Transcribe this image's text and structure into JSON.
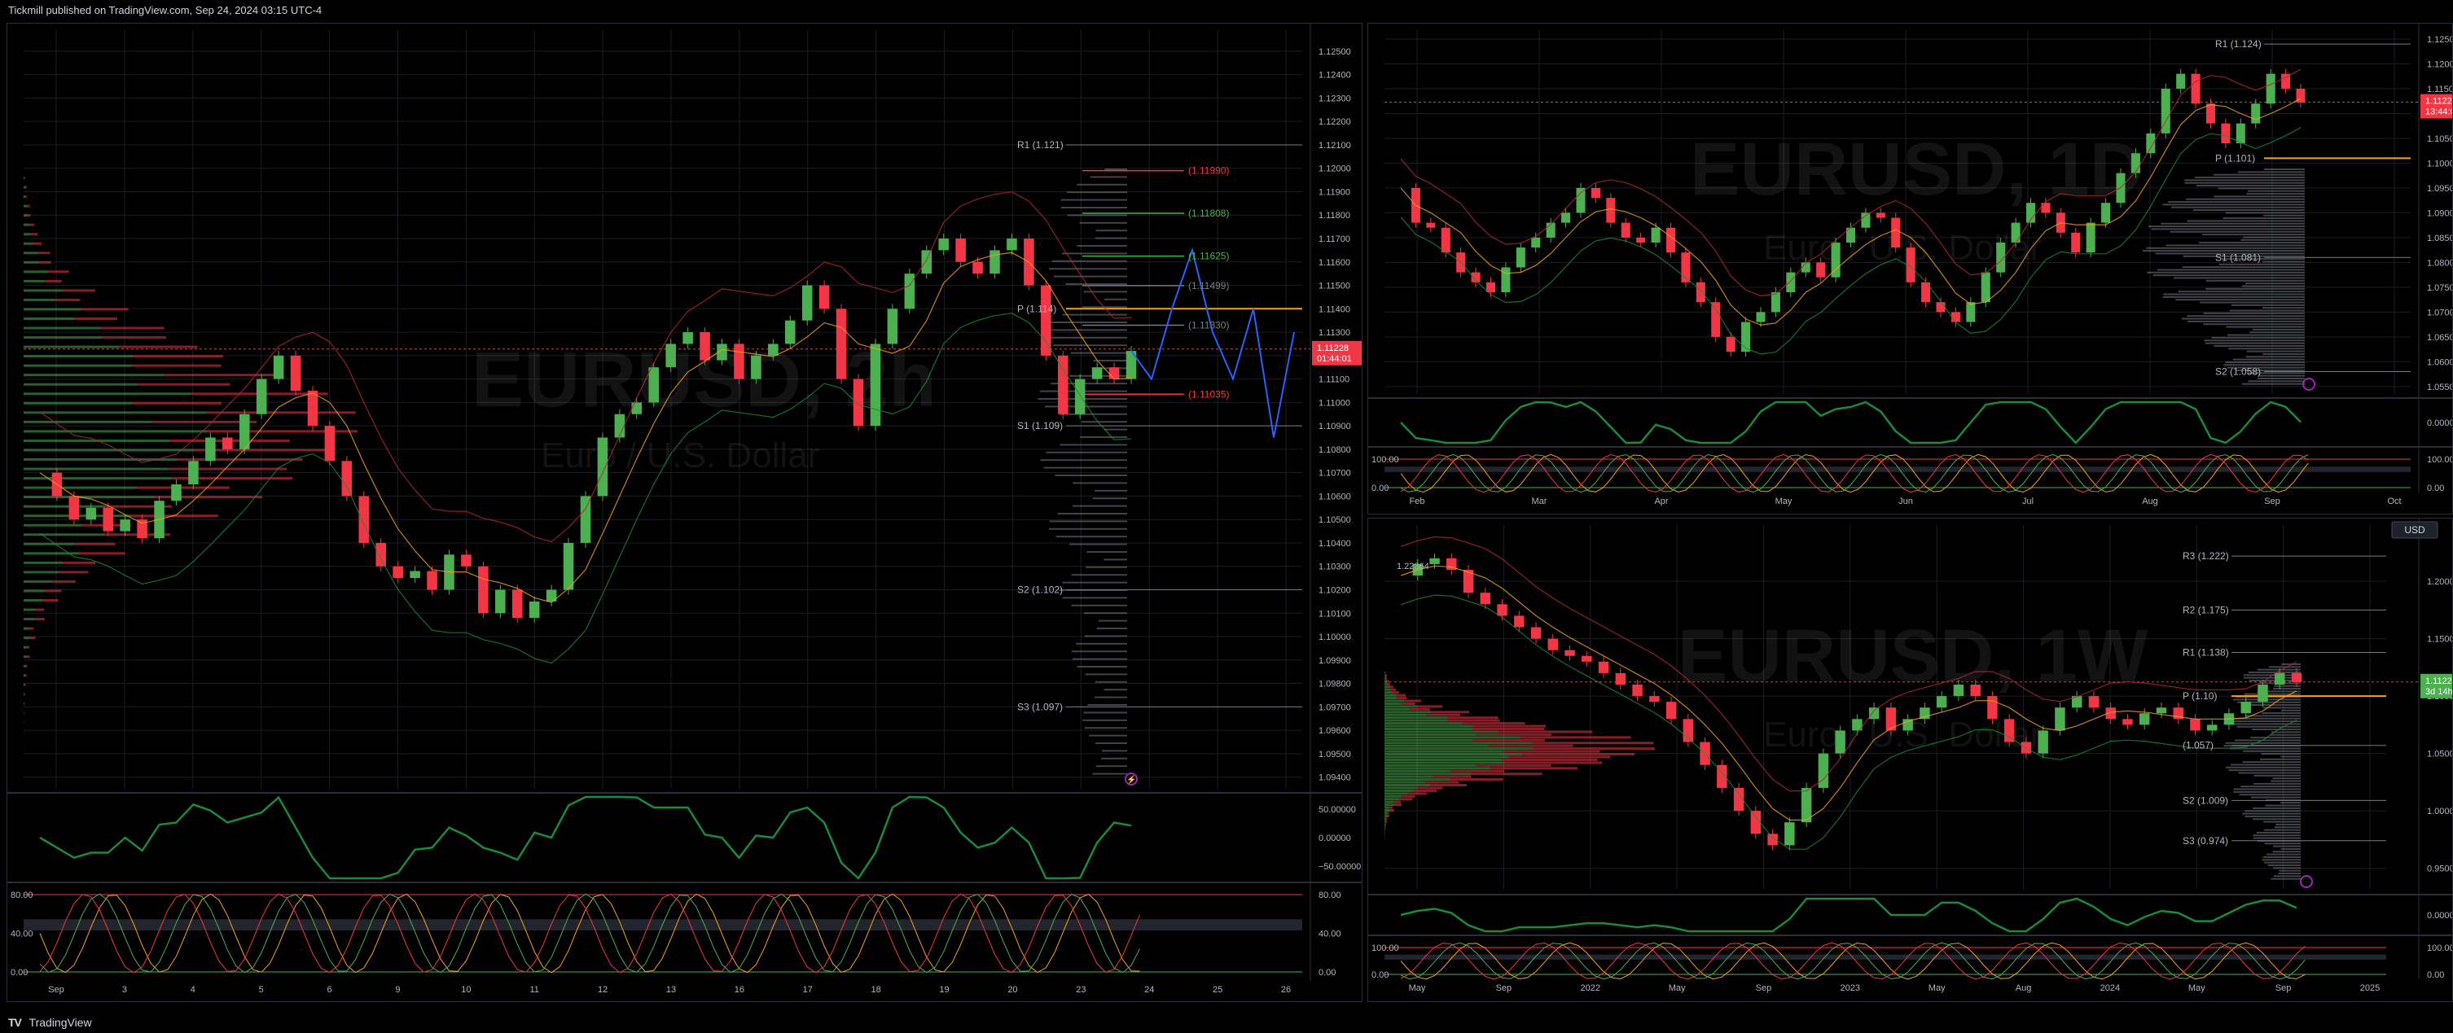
{
  "header": {
    "published_by": "Tickmill published on TradingView.com, Sep 24, 2024 03:15 UTC-4"
  },
  "footer": {
    "brand": "TradingView"
  },
  "colors": {
    "up": "#4caf50",
    "down": "#f23645",
    "pivot": "#f7a21b",
    "grid": "#1b1e25",
    "text": "#b2b5be"
  },
  "chart_data": [
    {
      "type": "line",
      "symbol": "EURUSD, 2h",
      "title": "EURUSD, 2h",
      "subtitle": "Euro / U.S. Dollar",
      "price_axis": [
        "1.12500",
        "1.12400",
        "1.12300",
        "1.12200",
        "1.12100",
        "1.12000",
        "1.11900",
        "1.11800",
        "1.11700",
        "1.11600",
        "1.11500",
        "1.11400",
        "1.11300",
        "1.11200",
        "1.11100",
        "1.11000",
        "1.10900",
        "1.10800",
        "1.10700",
        "1.10600",
        "1.10500",
        "1.10400",
        "1.10300",
        "1.10200",
        "1.10100",
        "1.10000",
        "1.09900",
        "1.09800",
        "1.09700",
        "1.09600",
        "1.09500",
        "1.09400"
      ],
      "ylim": [
        1.0935,
        1.1259
      ],
      "current_price": "1.11228",
      "countdown": "01:44:01",
      "time_axis": [
        "Sep",
        "3",
        "4",
        "5",
        "6",
        "9",
        "10",
        "11",
        "12",
        "13",
        "16",
        "17",
        "18",
        "19",
        "20",
        "23",
        "24",
        "25",
        "26"
      ],
      "pivot_labels": [
        {
          "text": "R1 (1.121)",
          "value": 1.121
        },
        {
          "text": "P (1.114)",
          "value": 1.114
        },
        {
          "text": "S1 (1.109)",
          "value": 1.109
        },
        {
          "text": "S2 (1.102)",
          "value": 1.102
        },
        {
          "text": "S3 (1.097)",
          "value": 1.097
        }
      ],
      "fib_labels": [
        {
          "text": "(1.11990)",
          "value": 1.1199
        },
        {
          "text": "(1.11808)",
          "value": 1.11808
        },
        {
          "text": "(1.11625)",
          "value": 1.11625
        },
        {
          "text": "(1.11499)",
          "value": 1.11499
        },
        {
          "text": "(1.11330)",
          "value": 1.1133
        },
        {
          "text": "(1.11035)",
          "value": 1.11035
        }
      ],
      "price_path": [
        1.107,
        1.106,
        1.105,
        1.1055,
        1.1045,
        1.105,
        1.1042,
        1.1058,
        1.1065,
        1.1075,
        1.1085,
        1.108,
        1.1095,
        1.111,
        1.112,
        1.1105,
        1.109,
        1.1075,
        1.106,
        1.104,
        1.103,
        1.1025,
        1.1028,
        1.102,
        1.1035,
        1.103,
        1.101,
        1.102,
        1.1008,
        1.1015,
        1.102,
        1.104,
        1.106,
        1.1085,
        1.1095,
        1.11,
        1.1115,
        1.1125,
        1.113,
        1.1118,
        1.1125,
        1.111,
        1.112,
        1.1125,
        1.1135,
        1.115,
        1.114,
        1.111,
        1.109,
        1.1125,
        1.114,
        1.1155,
        1.1165,
        1.117,
        1.116,
        1.1155,
        1.1165,
        1.117,
        1.115,
        1.112,
        1.1095,
        1.111,
        1.1115,
        1.111,
        1.1122
      ],
      "projection_path": [
        1.1122,
        1.111,
        1.114,
        1.1165,
        1.113,
        1.111,
        1.114,
        1.1085,
        1.113
      ],
      "rsi_axis": [
        "50.00000",
        "0.00000",
        "−50.00000"
      ],
      "stoch_axis": [
        "80.00",
        "40.00",
        "0.00"
      ]
    },
    {
      "type": "line",
      "symbol": "EURUSD, 1D",
      "title": "EURUSD, 1D",
      "subtitle": "Euro / U.S. Dollar",
      "price_axis": [
        "1.12500",
        "1.12000",
        "1.11500",
        "1.11000",
        "1.10500",
        "1.10000",
        "1.09500",
        "1.09000",
        "1.08500",
        "1.08000",
        "1.07500",
        "1.07000",
        "1.06500",
        "1.06000",
        "1.05500"
      ],
      "ylim": [
        1.0535,
        1.1268
      ],
      "current_price": "1.11228",
      "countdown": "13:44:01",
      "time_axis": [
        "Feb",
        "Mar",
        "Apr",
        "May",
        "Jun",
        "Jul",
        "Aug",
        "Sep",
        "Oct"
      ],
      "pivot_labels": [
        {
          "text": "R1 (1.124)",
          "value": 1.124
        },
        {
          "text": "P (1.101)",
          "value": 1.101
        },
        {
          "text": "S1 (1.081)",
          "value": 1.081
        },
        {
          "text": "S2 (1.058)",
          "value": 1.058
        }
      ],
      "price_path": [
        1.095,
        1.088,
        1.087,
        1.082,
        1.078,
        1.076,
        1.074,
        1.079,
        1.083,
        1.085,
        1.088,
        1.09,
        1.095,
        1.093,
        1.088,
        1.085,
        1.084,
        1.087,
        1.082,
        1.076,
        1.072,
        1.065,
        1.062,
        1.068,
        1.07,
        1.074,
        1.078,
        1.08,
        1.077,
        1.084,
        1.087,
        1.09,
        1.089,
        1.083,
        1.076,
        1.072,
        1.07,
        1.068,
        1.072,
        1.078,
        1.084,
        1.088,
        1.092,
        1.09,
        1.086,
        1.082,
        1.088,
        1.092,
        1.098,
        1.102,
        1.106,
        1.115,
        1.118,
        1.112,
        1.108,
        1.104,
        1.108,
        1.112,
        1.118,
        1.115,
        1.1122
      ],
      "rsi_axis": [
        "0.00000"
      ],
      "stoch_axis": [
        "100.00",
        "0.00"
      ]
    },
    {
      "type": "line",
      "symbol": "EURUSD, 1W",
      "title": "EURUSD, 1W",
      "subtitle": "Euro / U.S. Dollar",
      "price_axis": [
        "1.20000",
        "1.15000",
        "1.10000",
        "1.05000",
        "1.00000",
        "0.95000"
      ],
      "ylim": [
        0.932,
        1.249
      ],
      "current_price": "1.11228",
      "countdown": "3d 14h",
      "currency_button": "USD",
      "time_axis": [
        "May",
        "Sep",
        "2022",
        "May",
        "Sep",
        "2023",
        "May",
        "Aug",
        "2024",
        "May",
        "Sep",
        "2025"
      ],
      "pivot_labels": [
        {
          "text": "R3 (1.222)",
          "value": 1.222
        },
        {
          "text": "R2 (1.175)",
          "value": 1.175
        },
        {
          "text": "R1 (1.138)",
          "value": 1.138
        },
        {
          "text": "P (1.10)",
          "value": 1.1
        },
        {
          "text": "(1.057)",
          "value": 1.057
        },
        {
          "text": "S2 (1.009)",
          "value": 1.009
        },
        {
          "text": "S3 (0.974)",
          "value": 0.974
        }
      ],
      "side_label": "1.22364",
      "price_path": [
        1.205,
        1.215,
        1.22,
        1.21,
        1.19,
        1.18,
        1.17,
        1.16,
        1.15,
        1.14,
        1.135,
        1.13,
        1.12,
        1.11,
        1.1,
        1.095,
        1.08,
        1.06,
        1.04,
        1.02,
        1.0,
        0.98,
        0.97,
        0.99,
        1.02,
        1.05,
        1.07,
        1.08,
        1.09,
        1.07,
        1.08,
        1.09,
        1.1,
        1.11,
        1.1,
        1.08,
        1.06,
        1.05,
        1.07,
        1.09,
        1.1,
        1.09,
        1.08,
        1.075,
        1.085,
        1.09,
        1.08,
        1.07,
        1.075,
        1.085,
        1.095,
        1.11,
        1.12,
        1.1122
      ],
      "rsi_axis": [
        "0.00000"
      ],
      "stoch_axis": [
        "100.00",
        "0.00"
      ]
    }
  ]
}
